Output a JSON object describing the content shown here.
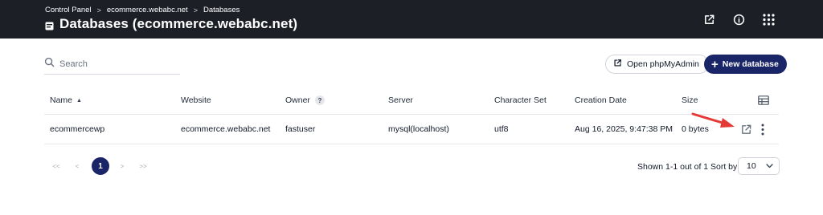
{
  "header": {
    "breadcrumb": [
      "Control Panel",
      "ecommerce.webabc.net",
      "Databases"
    ],
    "breadcrumb_separator": ">",
    "title": "Databases (ecommerce.webabc.net)",
    "icons": [
      "external-link-icon",
      "info-icon",
      "apps-grid-icon"
    ]
  },
  "toolbar": {
    "search_placeholder": "Search",
    "open_phpmyadmin_label": "Open phpMyAdmin",
    "new_database_label": "New database",
    "new_database_plus": "+"
  },
  "table": {
    "columns": [
      "Name",
      "Website",
      "Owner",
      "Server",
      "Character Set",
      "Creation Date",
      "Size"
    ],
    "sort_indicator": "▲",
    "owner_help": "?",
    "rows": [
      {
        "name": "ecommercewp",
        "website": "ecommerce.webabc.net",
        "owner": "fastuser",
        "server": "mysql(localhost)",
        "charset": "utf8",
        "created": "Aug 16, 2025, 9:47:38 PM",
        "size": "0 bytes"
      }
    ]
  },
  "pagination": {
    "first": "<<",
    "prev": "<",
    "current": "1",
    "next": ">",
    "last": ">>",
    "summary": "Shown 1-1 out of 1",
    "sort_by_label": "Sort by",
    "page_size": "10"
  },
  "colors": {
    "topbar": "#1d1f27",
    "primary": "#1a2567",
    "annotation_arrow": "#e53935"
  }
}
